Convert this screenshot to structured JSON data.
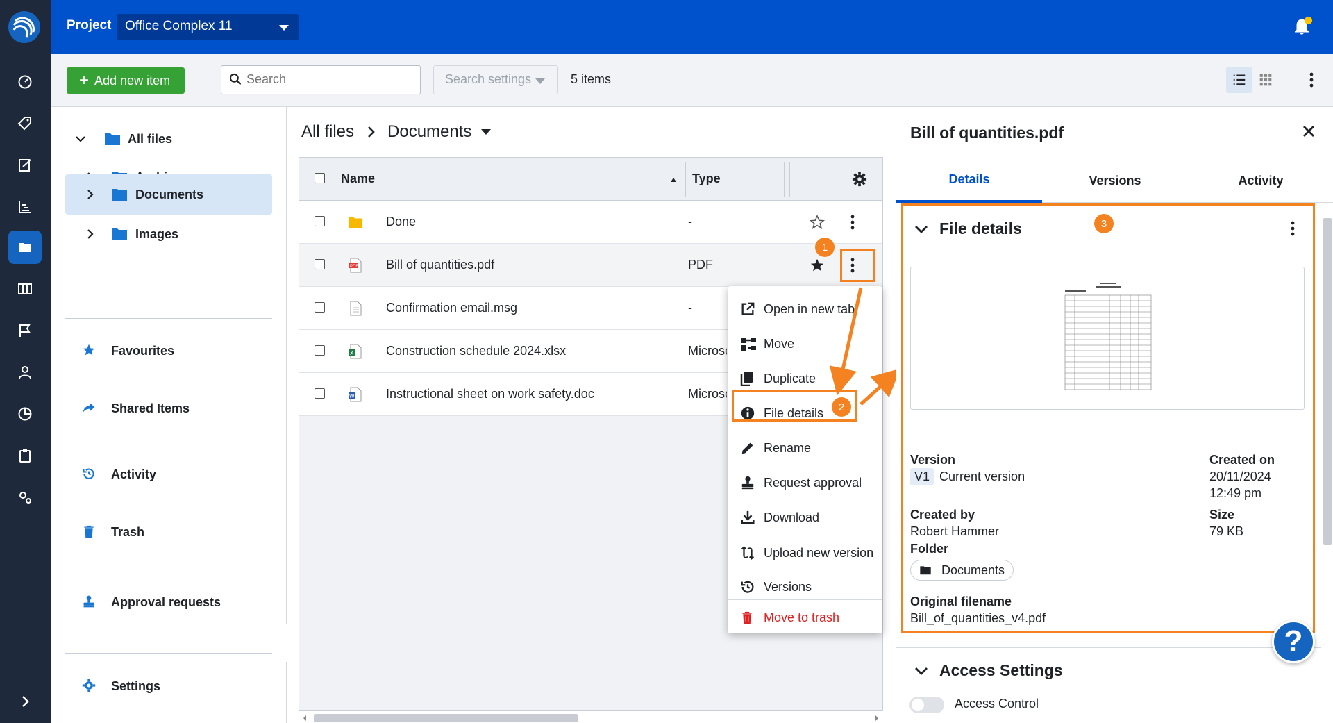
{
  "top_bar": {
    "project_label": "Project",
    "project_name": "Office Complex 11"
  },
  "toolbar": {
    "add_label": "Add new item",
    "search_placeholder": "Search",
    "search_settings_label": "Search settings",
    "item_count": "5 items"
  },
  "sidebar": {
    "all_files": "All files",
    "folders": [
      "Archive",
      "Documents",
      "Images"
    ],
    "favourites": "Favourites",
    "shared": "Shared Items",
    "activity": "Activity",
    "trash": "Trash",
    "approvals": "Approval requests",
    "settings": "Settings"
  },
  "breadcrumb": {
    "root": "All files",
    "current": "Documents"
  },
  "table": {
    "columns": {
      "name": "Name",
      "type": "Type"
    },
    "rows": [
      {
        "name": "Done",
        "type": "-",
        "icon": "folder-icon"
      },
      {
        "name": "Bill of quantities.pdf",
        "type": "PDF",
        "icon": "pdf-file-icon"
      },
      {
        "name": "Confirmation email.msg",
        "type": "-",
        "icon": "generic-file-icon"
      },
      {
        "name": "Construction schedule 2024.xlsx",
        "type": "Microsoft Excel",
        "icon": "excel-file-icon"
      },
      {
        "name": "Instructional sheet on work safety.doc",
        "type": "Microsoft Word",
        "icon": "word-file-icon"
      }
    ]
  },
  "context_menu": {
    "items": [
      "Open in new tab",
      "Move",
      "Duplicate",
      "File details",
      "Rename",
      "Request approval",
      "Download",
      "Upload new version",
      "Versions",
      "Move to trash"
    ]
  },
  "step_badges": [
    "1",
    "2",
    "3"
  ],
  "panel": {
    "title": "Bill of quantities.pdf",
    "tabs": [
      "Details",
      "Versions",
      "Activity"
    ],
    "file_details_heading": "File details",
    "version_label": "Version",
    "version_badge": "V1",
    "version_value": "Current version",
    "created_on_label": "Created on",
    "created_on_date": "20/11/2024",
    "created_on_time": "12:49 pm",
    "created_by_label": "Created by",
    "created_by_value": "Robert Hammer",
    "size_label": "Size",
    "size_value": "79 KB",
    "folder_label": "Folder",
    "folder_value": "Documents",
    "original_filename_label": "Original filename",
    "original_filename_value": "Bill_of_quantities_v4.pdf",
    "access_heading": "Access Settings",
    "access_control_label": "Access Control"
  },
  "help_label": "?",
  "colors": {
    "brand_blue": "#0052cc",
    "rail": "#1e2a3c",
    "add_green": "#36a235",
    "highlight_orange": "#f58220",
    "danger_red": "#e02020"
  }
}
